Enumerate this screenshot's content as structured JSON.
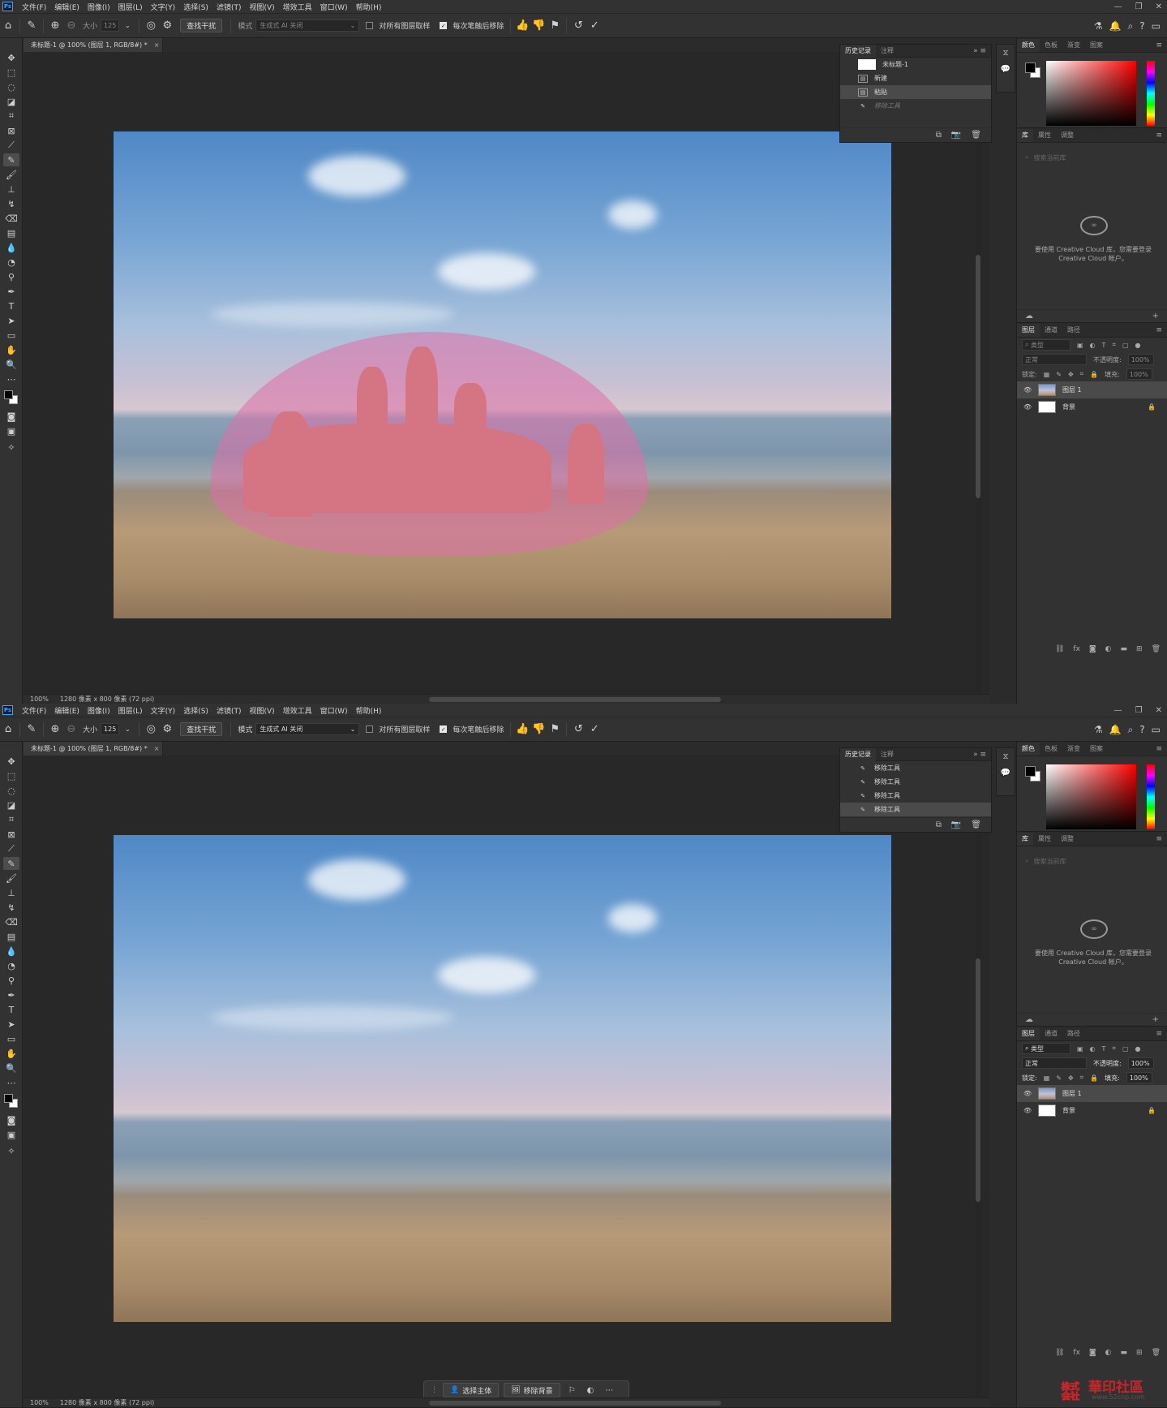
{
  "menu": [
    "文件(F)",
    "编辑(E)",
    "图像(I)",
    "图层(L)",
    "文字(Y)",
    "选择(S)",
    "滤镜(T)",
    "视图(V)",
    "增效工具",
    "窗口(W)",
    "帮助(H)"
  ],
  "logo": "Ps",
  "options": {
    "size_label": "大小",
    "size_value": "125",
    "find_distractions": "查找干扰",
    "mode_label": "模式",
    "mode_value": "生成式 AI 关闭",
    "sample_all_layers": "对所有图层取样",
    "remove_after_each_stroke": "每次笔触后移除"
  },
  "doc_tab": "未标题-1 @ 100% (图层 1, RGB/8#) *",
  "status": {
    "zoom": "100%",
    "info": "1280 像素 x 800 像素 (72 ppi)"
  },
  "history_tabs": [
    "历史记录",
    "注释"
  ],
  "history1": {
    "snapshot": "未标题-1",
    "items": [
      {
        "label": "新建",
        "selected": false,
        "dim": false
      },
      {
        "label": "粘贴",
        "selected": true,
        "dim": false
      },
      {
        "label": "移除工具",
        "selected": false,
        "dim": true
      }
    ]
  },
  "history2": {
    "items": [
      {
        "label": "移除工具",
        "selected": false
      },
      {
        "label": "移除工具",
        "selected": false
      },
      {
        "label": "移除工具",
        "selected": false
      },
      {
        "label": "移除工具",
        "selected": true
      }
    ]
  },
  "color_tabs": [
    "颜色",
    "色板",
    "渐变",
    "图案"
  ],
  "library_tabs": [
    "库",
    "属性",
    "调整"
  ],
  "library": {
    "search_placeholder": "搜索当前库",
    "cc_message": "要使用 Creative Cloud 库，您需要登录 Creative Cloud 帐户。"
  },
  "layers_tabs": [
    "图层",
    "通道",
    "路径"
  ],
  "layers": {
    "filter": "类型",
    "blend_mode": "正常",
    "opacity_label": "不透明度:",
    "opacity_value": "100%",
    "lock_label": "锁定:",
    "fill_label": "填充:",
    "fill_value": "100%",
    "items": [
      {
        "name": "图层 1",
        "selected": true,
        "locked": false
      },
      {
        "name": "背景",
        "selected": false,
        "locked": true
      }
    ]
  },
  "taskbar": {
    "select_subject": "选择主体",
    "remove_background": "移除背景"
  },
  "watermark": {
    "title": "華印社區",
    "url": "www.52cnp.com"
  },
  "colors": {
    "accent_ps": "#31a8ff",
    "mask_pink": "#de70a8",
    "panel_bg": "#323232",
    "canvas_bg": "#282828"
  }
}
